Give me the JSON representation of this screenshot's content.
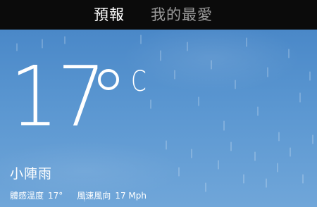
{
  "tabs": {
    "forecast": "預報",
    "favorites": "我的最愛"
  },
  "weather": {
    "temperature": "17",
    "unit": "C",
    "condition": "小陣雨",
    "feels_like_label": "體感溫度",
    "feels_like_value": "17°",
    "wind_label": "風速風向",
    "wind_value": "17 Mph"
  },
  "colors": {
    "topbar": "#0b0b0b",
    "active_tab": "#ffffff",
    "inactive_tab": "#9a9a9a",
    "sky_top": "#4a88c8",
    "sky_bottom": "#70a6d9"
  }
}
